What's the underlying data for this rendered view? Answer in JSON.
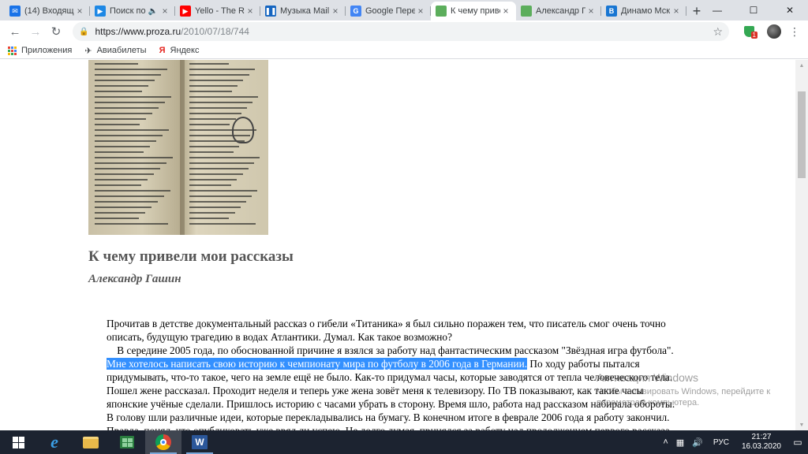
{
  "browser": {
    "tabs": [
      {
        "title": "(14) Входящие",
        "icon": "mail-icon",
        "color": "#1a73e8",
        "active": false
      },
      {
        "title": "Поиск по",
        "icon": "play-icon",
        "color": "#1e88e5",
        "active": false,
        "audio": true
      },
      {
        "title": "Yello - The Race",
        "icon": "youtube-icon",
        "color": "#ff0000",
        "active": false
      },
      {
        "title": "Музыка Mail.Ru",
        "icon": "music-icon",
        "color": "#1565c0",
        "active": false
      },
      {
        "title": "Google Переводчик",
        "icon": "translate-icon",
        "color": "#4285f4",
        "active": false
      },
      {
        "title": "К чему привели",
        "icon": "proza-icon",
        "color": "#5cae5c",
        "active": true
      },
      {
        "title": "Александр Гашин",
        "icon": "proza-icon",
        "color": "#5cae5c",
        "active": false
      },
      {
        "title": "Динамо Мск (с",
        "icon": "site-icon",
        "color": "#1976d2",
        "active": false
      }
    ],
    "new_tab": "+",
    "window_controls": {
      "minimize": "—",
      "maximize": "☐",
      "close": "✕"
    },
    "url": {
      "host": "https://www.proza.ru",
      "path": "/2010/07/18/744"
    },
    "extension_badge": "1",
    "bookmarks": [
      {
        "label": "Приложения",
        "icon": "apps-grid-icon"
      },
      {
        "label": "Авиабилеты",
        "icon": "airplane-icon"
      },
      {
        "label": "Яндекс",
        "icon": "yandex-icon"
      }
    ]
  },
  "article": {
    "title": "К чему привели мои рассказы",
    "author": "Александр Гашин",
    "lines": [
      {
        "pre": "Прочитав в детстве документальный рассказ о гибели «Титаника» я был сильно поражен тем, что писатель смог очень точно",
        "hl": "",
        "post": ""
      },
      {
        "pre": "описать, будущую трагедию в водах Атлантики. Думал. Как такое возможно?",
        "hl": "",
        "post": ""
      },
      {
        "pre": "    В середине 2005 года, по обоснованной причине я взялся за работу над фантастическим рассказом \"Звёздная игра футбола\".",
        "hl": "",
        "post": ""
      },
      {
        "pre": "",
        "hl": "Мне хотелось написать свою историю к чемпионату мира по футболу в 2006 года в Германии.",
        "post": " По ходу работы пытался"
      },
      {
        "pre": "придумывать, что-то такое, чего на земле ещё не было. Как-то придумал часы, которые заводятся от тепла человеческого тела.",
        "hl": "",
        "post": ""
      },
      {
        "pre": "Пошел жене рассказал. Проходит неделя и теперь уже жена зовёт меня к телевизору. По ТВ показывают, как такие часы",
        "hl": "",
        "post": ""
      },
      {
        "pre": "японские учёные сделали. Пришлось историю с часами убрать в сторону. Время шло, работа над рассказом набирала обороты.",
        "hl": "",
        "post": ""
      },
      {
        "pre": "В голову шли различные идеи, которые перекладывались на бумагу. В конечном итоге в феврале 2006 года я работу закончил.",
        "hl": "",
        "post": ""
      },
      {
        "pre": "Правда, понял, что опубликовать уже вряд ли успею. Не долго думая, принялся за работу над продолжением первого рассказа",
        "hl": "",
        "post": ""
      }
    ]
  },
  "watermark": {
    "line1": "Активация Windows",
    "line2": "Чтобы активировать Windows, перейдите к",
    "line3": "параметрам компьютера."
  },
  "taskbar": {
    "apps": [
      {
        "name": "internet-explorer-icon"
      },
      {
        "name": "file-explorer-icon"
      },
      {
        "name": "store-icon"
      },
      {
        "name": "chrome-icon"
      },
      {
        "name": "word-icon"
      }
    ],
    "lang": "РУС",
    "time": "21:27",
    "date": "16.03.2020"
  }
}
